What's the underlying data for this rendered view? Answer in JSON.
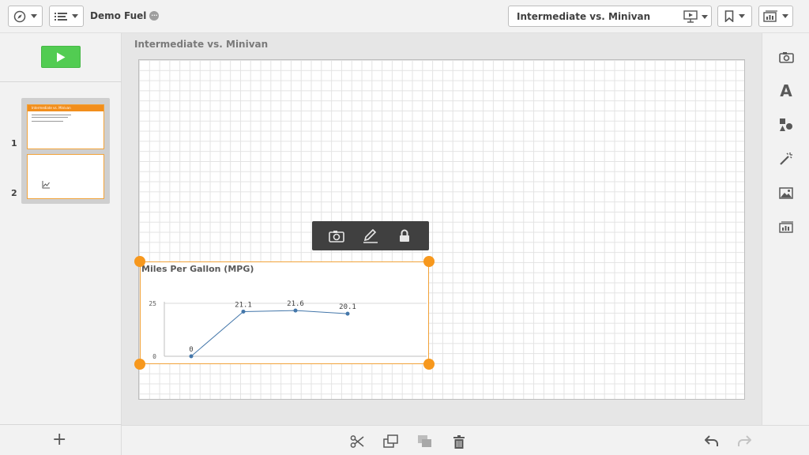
{
  "app": {
    "title": "Demo Fuel",
    "status_badge": "···"
  },
  "header": {
    "nav_icon": "compass-icon",
    "menu_icon": "list-icon",
    "sheet_selector": "Intermediate vs. Minivan",
    "presentation_icon": "presentation-icon",
    "bookmark_icon": "bookmark-icon",
    "story_icon": "story-icon"
  },
  "left": {
    "play_icon": "play-icon",
    "slides": [
      {
        "number": "1",
        "thumb_title": "Intermediate vs. Minivan"
      },
      {
        "number": "2",
        "thumb_title": ""
      }
    ],
    "add_label": "+"
  },
  "sheet": {
    "title": "Intermediate vs. Minivan"
  },
  "object_toolbar": {
    "icons": [
      "camera-icon",
      "pencil-icon",
      "lock-icon"
    ]
  },
  "chart": {
    "title": "Miles Per Gallon (MPG)"
  },
  "chart_data": {
    "type": "line",
    "title": "Miles Per Gallon (MPG)",
    "x": [
      "",
      "",
      "",
      ""
    ],
    "series": [
      {
        "values": [
          0,
          21.1,
          21.6,
          20.1
        ]
      }
    ],
    "data_labels": [
      "0",
      "21.1",
      "21.6",
      "20.1"
    ],
    "yticks": [
      "0",
      "25"
    ],
    "ylim": [
      0,
      25
    ],
    "grid": true,
    "color": "#4477aa"
  },
  "right_panel": {
    "icons": [
      "snapshot-icon",
      "text-icon",
      "shapes-icon",
      "effects-icon",
      "image-icon",
      "sheet-icon"
    ],
    "text_icon_label": "A"
  },
  "bottom": {
    "icons": [
      "cut-icon",
      "copy-icon",
      "paste-icon",
      "delete-icon",
      "undo-icon",
      "redo-icon"
    ]
  },
  "colors": {
    "accent": "#f7981d",
    "play": "#52cc52",
    "toolbar": "#404040"
  }
}
